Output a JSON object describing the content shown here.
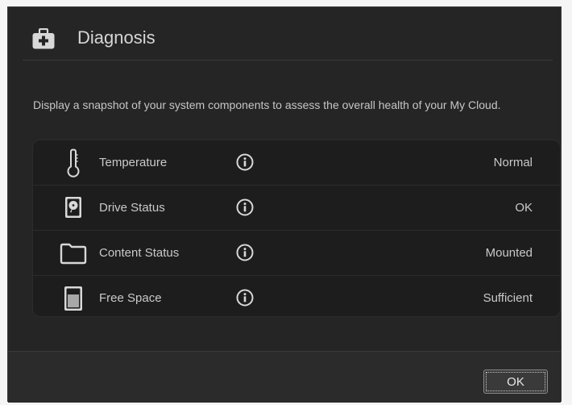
{
  "dialog": {
    "title": "Diagnosis",
    "title_icon": "first-aid-kit-icon",
    "description": "Display a snapshot of your system components to assess the overall health of your My Cloud.",
    "rows": [
      {
        "icon": "thermometer-icon",
        "label": "Temperature",
        "value": "Normal"
      },
      {
        "icon": "hard-drive-icon",
        "label": "Drive Status",
        "value": "OK"
      },
      {
        "icon": "folder-icon",
        "label": "Content Status",
        "value": "Mounted"
      },
      {
        "icon": "storage-gauge-icon",
        "label": "Free Space",
        "value": "Sufficient"
      }
    ],
    "info_icon": "info-icon",
    "ok_label": "OK"
  },
  "colors": {
    "dialog_bg": "#252525",
    "panel_bg": "#1d1d1d",
    "text": "#c9c9c9",
    "title": "#d6d6d6",
    "footer_bg": "#2b2b2b"
  }
}
